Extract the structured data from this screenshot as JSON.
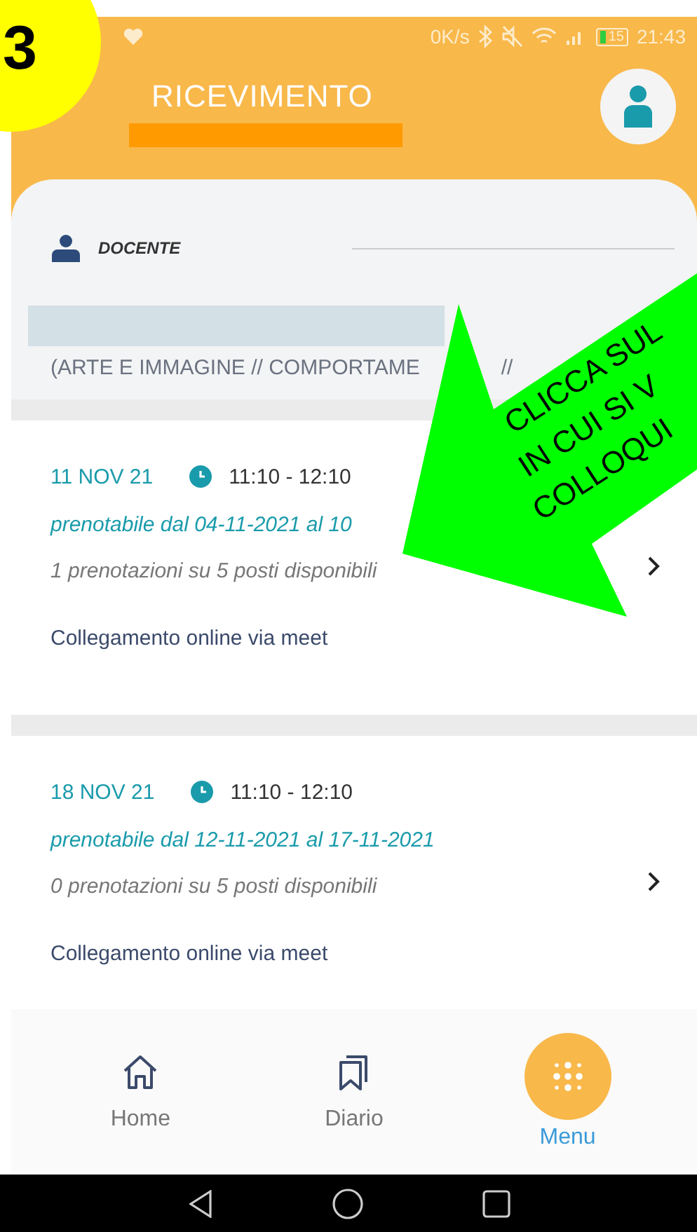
{
  "annotation": {
    "step": "3",
    "callout_lines": [
      "CLICCA SUL",
      "IN CUI SI V",
      "COLLOQUI"
    ]
  },
  "status_bar": {
    "speed": "0K/s",
    "battery": "15",
    "time": "21:43"
  },
  "header": {
    "title": "RICEVIMENTO"
  },
  "teacher": {
    "label": "DOCENTE"
  },
  "subjects": {
    "visible_start": "(ARTE E IMMAGINE // COMPORTAME",
    "visible_end": "//"
  },
  "slots": [
    {
      "date": "11 NOV 21",
      "time": "11:10 - 12:10",
      "window": "prenotabile dal 04-11-2021 al 10",
      "bookings": "1 prenotazioni su 5 posti disponibili",
      "mode": "Collegamento online via meet"
    },
    {
      "date": "18 NOV 21",
      "time": "11:10 - 12:10",
      "window": "prenotabile dal 12-11-2021 al 17-11-2021",
      "bookings": "0 prenotazioni su 5 posti disponibili",
      "mode": "Collegamento online via meet"
    }
  ],
  "nav": [
    {
      "kind": "home",
      "label": "Home",
      "selected": false
    },
    {
      "kind": "diary",
      "label": "Diario",
      "selected": false
    },
    {
      "kind": "menu",
      "label": "Menu",
      "selected": true
    }
  ]
}
